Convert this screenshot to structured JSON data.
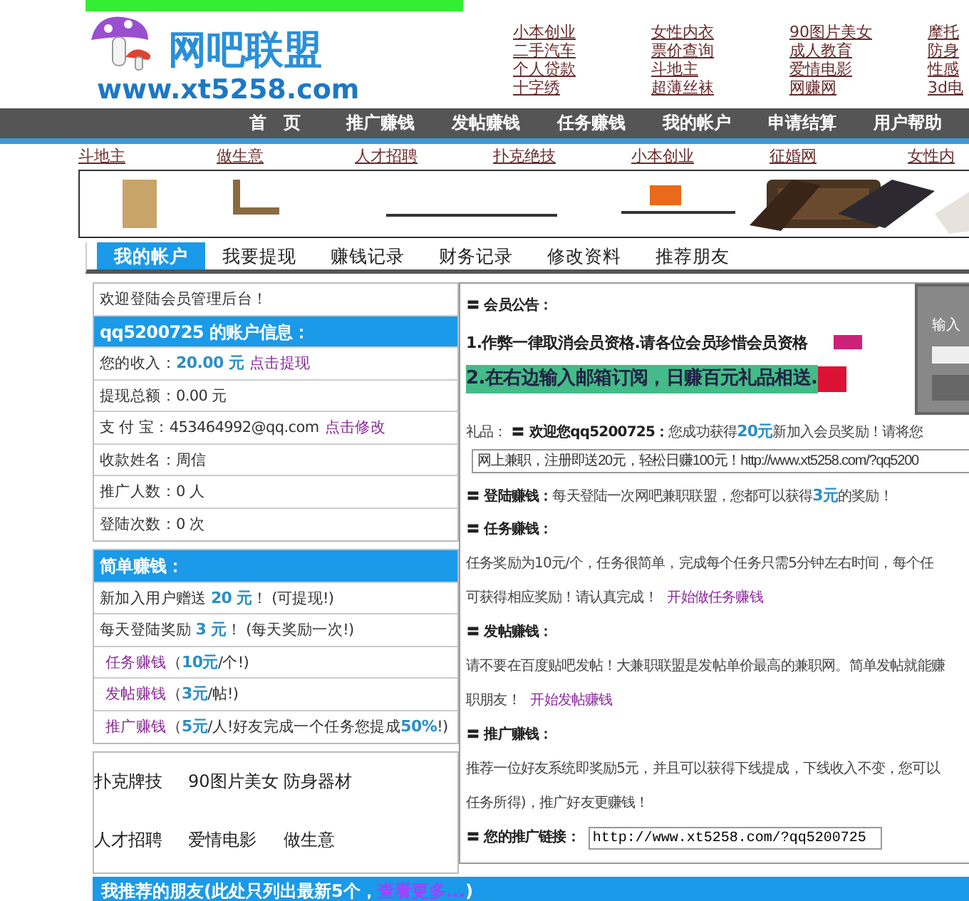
{
  "logo": {
    "title": "网吧联盟",
    "url": "www.xt5258.com"
  },
  "header_links": [
    [
      "小本创业",
      "二手汽车",
      "个人贷款",
      "十字绣"
    ],
    [
      "女性内衣",
      "票价查询",
      "斗地主",
      "超薄丝袜"
    ],
    [
      "90图片美女",
      "成人教育",
      "爱情电影",
      "网赚网"
    ],
    [
      "摩托",
      "防身",
      "性感",
      "3d电"
    ]
  ],
  "nav": [
    "首　页",
    "推广赚钱",
    "发帖赚钱",
    "任务赚钱",
    "我的帐户",
    "申请结算",
    "用户帮助"
  ],
  "link_row": [
    "斗地主",
    "做生意",
    "人才招聘",
    "扑克绝技",
    "小本创业",
    "征婚网",
    "女性内"
  ],
  "tabs": [
    {
      "label": "我的帐户",
      "selected": true
    },
    {
      "label": "我要提现",
      "selected": false
    },
    {
      "label": "赚钱记录",
      "selected": false
    },
    {
      "label": "财务记录",
      "selected": false
    },
    {
      "label": "修改资料",
      "selected": false
    },
    {
      "label": "推荐朋友",
      "selected": false
    }
  ],
  "account_box": {
    "welcome": "欢迎登陆会员管理后台！",
    "header": "qq5200725 的账户信息：",
    "rows": [
      [
        {
          "kind": "text",
          "text": "您的收入："
        },
        {
          "kind": "value",
          "text": "20.00 元"
        },
        {
          "kind": "link",
          "text": "点击提现"
        }
      ],
      [
        {
          "kind": "text",
          "text": "提现总额：0.00 元"
        }
      ],
      [
        {
          "kind": "text",
          "text": "支 付 宝：453464992@qq.com"
        },
        {
          "kind": "link",
          "text": "点击修改"
        }
      ],
      [
        {
          "kind": "text",
          "text": "收款姓名：周信"
        }
      ],
      [
        {
          "kind": "text",
          "text": "推广人数：0 人"
        }
      ],
      [
        {
          "kind": "text",
          "text": "登陆次数：0 次"
        }
      ]
    ]
  },
  "earn_box": {
    "header": "简单赚钱：",
    "rows": [
      [
        {
          "kind": "text",
          "text": "新加入用户赠送 "
        },
        {
          "kind": "value",
          "text": "20 元"
        },
        {
          "kind": "text",
          "text": "！ (可提现!)"
        }
      ],
      [
        {
          "kind": "text",
          "text": "每天登陆奖励 "
        },
        {
          "kind": "value",
          "text": "3 元"
        },
        {
          "kind": "text",
          "text": "！ (每天奖励一次!)"
        }
      ],
      [
        {
          "kind": "link",
          "text": "任务赚钱"
        },
        {
          "kind": "text",
          "text": "（"
        },
        {
          "kind": "value",
          "text": "10元"
        },
        {
          "kind": "text",
          "text": "/个!)"
        }
      ],
      [
        {
          "kind": "link",
          "text": "发帖赚钱"
        },
        {
          "kind": "text",
          "text": "（"
        },
        {
          "kind": "value",
          "text": "3元"
        },
        {
          "kind": "text",
          "text": "/帖!)"
        }
      ],
      [
        {
          "kind": "link",
          "text": "推广赚钱"
        },
        {
          "kind": "text",
          "text": "（"
        },
        {
          "kind": "value",
          "text": "5元"
        },
        {
          "kind": "text",
          "text": "/人!好友完成一个任务您提成"
        },
        {
          "kind": "value",
          "text": "50%"
        },
        {
          "kind": "text",
          "text": "!)"
        }
      ]
    ]
  },
  "quick_links": [
    "扑克牌技",
    "90图片美女",
    "防身器材",
    "人才招聘",
    "爱情电影",
    "做生意"
  ],
  "friends_bar": [
    {
      "kind": "bold",
      "text": "我推荐的朋友(此处只列出最新5个，"
    },
    {
      "kind": "link",
      "text": "查看更多..."
    },
    {
      "kind": "bold",
      "text": ")"
    }
  ],
  "notice": {
    "title": "〓 会员公告：",
    "items": [
      {
        "text": "1.作弊一律取消会员资格.请各位会员珍惜会员资格",
        "highlight": false,
        "color": "#cc2277"
      },
      {
        "text": "2.在右边输入邮箱订阅，日赚百元礼品相送.",
        "highlight": true,
        "color": "#dd1133"
      }
    ]
  },
  "subscribe": {
    "label": "输入"
  },
  "welcome_line": [
    {
      "kind": "text",
      "text": "礼品： "
    },
    {
      "kind": "bold",
      "text": "〓 欢迎您qq5200725："
    },
    {
      "kind": "text",
      "text": "您成功获得"
    },
    {
      "kind": "value",
      "text": "20元"
    },
    {
      "kind": "text",
      "text": "新加入会员奖励！请将您"
    }
  ],
  "share_text": "网上兼职，注册即送20元，轻松日赚100元！http://www.xt5258.com/?qq5200",
  "sections": [
    [
      {
        "kind": "bold",
        "text": "〓 登陆赚钱："
      },
      {
        "kind": "text",
        "text": "每天登陆一次网吧兼职联盟，您都可以获得"
      },
      {
        "kind": "value",
        "text": "3元"
      },
      {
        "kind": "text",
        "text": "的奖励！"
      }
    ],
    [
      {
        "kind": "bold",
        "text": "〓 任务赚钱："
      }
    ],
    [
      {
        "kind": "text",
        "text": "任务奖励为10元/个，任务很简单，完成每个任务只需5分钟左右时间，每个任"
      }
    ],
    [
      {
        "kind": "text",
        "text": "可获得相应奖励！请认真完成！ "
      },
      {
        "kind": "link",
        "text": "开始做任务赚钱"
      }
    ],
    [
      {
        "kind": "bold",
        "text": "〓 发帖赚钱："
      }
    ],
    [
      {
        "kind": "text",
        "text": "请不要在百度贴吧发帖！大兼职联盟是发帖单价最高的兼职网。简单发帖就能赚"
      }
    ],
    [
      {
        "kind": "text",
        "text": "职朋友！ "
      },
      {
        "kind": "link",
        "text": "开始发帖赚钱"
      }
    ],
    [
      {
        "kind": "bold",
        "text": "〓 推广赚钱："
      }
    ],
    [
      {
        "kind": "text",
        "text": "推荐一位好友系统即奖励5元，并且可以获得下线提成，下线收入不变，您可以"
      }
    ],
    [
      {
        "kind": "text",
        "text": "任务所得)，推广好友更赚钱！"
      }
    ]
  ],
  "promo_link": {
    "label": "〓 您的推广链接：",
    "value": "http://www.xt5258.com/?qq5200725"
  }
}
